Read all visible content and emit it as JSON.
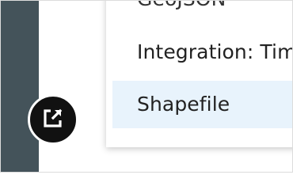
{
  "menu": {
    "items": [
      {
        "label": "GeoJSON"
      },
      {
        "label": "Integration: Tim"
      },
      {
        "label": "Shapefile"
      }
    ]
  },
  "fab": {
    "icon": "open-in-new-icon"
  },
  "colors": {
    "rail": "#44535a",
    "highlight": "#e8f3fc",
    "fab": "#111111"
  }
}
